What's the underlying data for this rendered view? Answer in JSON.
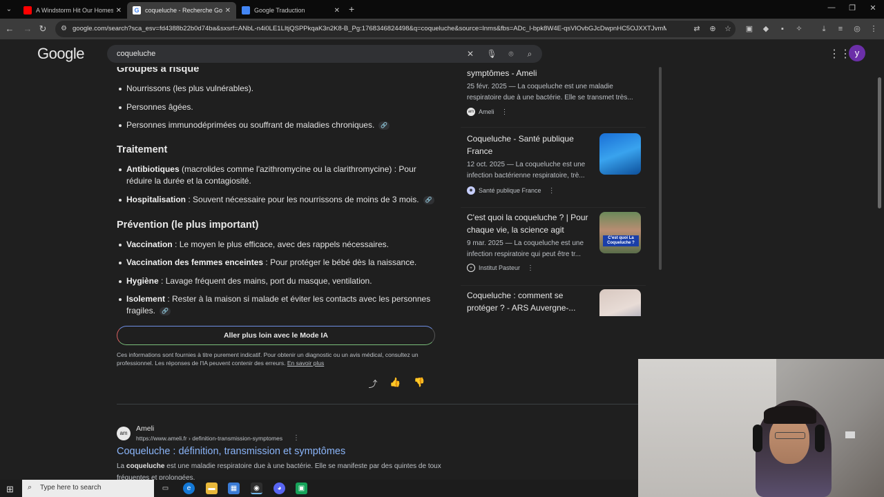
{
  "browser": {
    "tabs": [
      {
        "title": "A Windstorm Hit Our Homeste",
        "favicon_color": "#ff0000"
      },
      {
        "title": "coqueluche - Recherche Googl",
        "favicon_color": "#4285f4"
      },
      {
        "title": "Google Traduction",
        "favicon_color": "#4285f4"
      }
    ],
    "url": "google.com/search?sca_esv=fd4388b22b0d74ba&sxsrf=ANbL-n4i0LE1LItjQSPPkqaK3n2K8-B_Pg:1768346824498&q=coqueluche&source=lnms&fbs=ADc_l-bpk8W4E-qsVlOvbGJcDwpnHC5OJXXTJvmMu2n9YYx-G8x..."
  },
  "google": {
    "logo": "Google",
    "query": "coqueluche",
    "avatar_letter": "y"
  },
  "ai_overview": {
    "groups_title": "Groupes à risque",
    "groups": [
      "Nourrissons (les plus vulnérables).",
      "Personnes âgées.",
      "Personnes immunodéprimées ou souffrant de maladies chroniques."
    ],
    "treatment_title": "Traitement",
    "treatment": [
      {
        "bold": "Antibiotiques",
        "text": " (macrolides comme l'azithromycine ou la clarithromycine) : Pour réduire la durée et la contagiosité."
      },
      {
        "bold": "Hospitalisation",
        "text": " : Souvent nécessaire pour les nourrissons de moins de 3 mois."
      }
    ],
    "prevention_title": "Prévention (le plus important)",
    "prevention": [
      {
        "bold": "Vaccination",
        "text": " : Le moyen le plus efficace, avec des rappels nécessaires."
      },
      {
        "bold": "Vaccination des femmes enceintes",
        "text": " : Pour protéger le bébé dès la naissance."
      },
      {
        "bold": "Hygiène",
        "text": " : Lavage fréquent des mains, port du masque, ventilation."
      },
      {
        "bold": "Isolement",
        "text": " : Rester à la maison si malade et éviter les contacts avec les personnes fragiles."
      }
    ],
    "ai_mode_button": "Aller plus loin avec le Mode IA",
    "disclaimer": "Ces informations sont fournies à titre purement indicatif. Pour obtenir un diagnostic ou un avis médical, consultez un professionnel. Les réponses de l'IA peuvent contenir des erreurs.",
    "learn_more": "En savoir plus"
  },
  "sources": [
    {
      "title": "symptômes - Ameli",
      "meta": "25 févr. 2025 — La coqueluche est une maladie respiratoire due à une bactérie. Elle se transmet très...",
      "source": "Ameli"
    },
    {
      "title": "Coqueluche - Santé publique France",
      "meta": "12 oct. 2025 — La coqueluche est une infection bactérienne respiratoire, trè...",
      "source": "Santé publique France"
    },
    {
      "title": "C'est quoi la coqueluche ? | Pour chaque vie, la science agit",
      "meta": "9 mar. 2025 — La coqueluche est une infection respiratoire qui peut être tr...",
      "source": "Institut Pasteur",
      "thumb_text": "C'est quoi\nLa Coqueluche ?"
    },
    {
      "title": "Coqueluche : comment se protéger ? - ARS Auvergne-...",
      "meta": "",
      "source": ""
    }
  ],
  "result": {
    "site": "Ameli",
    "url": "https://www.ameli.fr › definition-transmission-symptomes",
    "title": "Coqueluche : définition, transmission et symptômes",
    "snippet_bold": "coqueluche",
    "snippet_pre": "La ",
    "snippet_post": " est une maladie respiratoire due à une bactérie. Elle se manifeste par des quintes de toux fréquentes et prolongées."
  },
  "taskbar": {
    "search_placeholder": "Type here to search"
  }
}
